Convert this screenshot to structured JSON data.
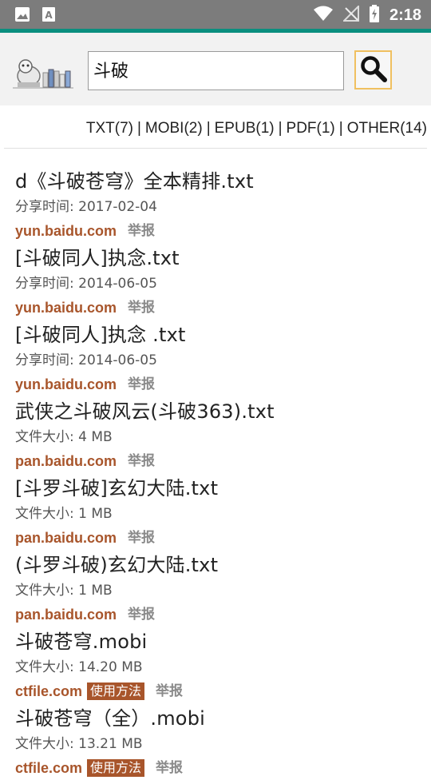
{
  "status_bar": {
    "time": "2:18",
    "left_icons": [
      "image-icon",
      "text-a-icon"
    ],
    "right_icons": [
      "wifi-icon",
      "no-signal-icon",
      "battery-charging-icon"
    ]
  },
  "header": {
    "search_value": "斗破",
    "search_icon": "magnifier-icon"
  },
  "filters": {
    "items": [
      {
        "label": "TXT(7)"
      },
      {
        "label": "MOBI(2)"
      },
      {
        "label": "EPUB(1)"
      },
      {
        "label": "PDF(1)"
      },
      {
        "label": "OTHER(14)"
      }
    ],
    "separator": "|"
  },
  "results": [
    {
      "title": "d《斗破苍穹》全本精排.txt",
      "meta": "分享时间: 2017-02-04",
      "source": "yun.baidu.com",
      "usage": "",
      "report": "举报"
    },
    {
      "title": "[斗破同人]执念.txt",
      "meta": "分享时间: 2014-06-05",
      "source": "yun.baidu.com",
      "usage": "",
      "report": "举报"
    },
    {
      "title": "[斗破同人]执念 .txt",
      "meta": "分享时间: 2014-06-05",
      "source": "yun.baidu.com",
      "usage": "",
      "report": "举报"
    },
    {
      "title": "武侠之斗破风云(斗破363).txt",
      "meta": "文件大小: 4 MB",
      "source": "pan.baidu.com",
      "usage": "",
      "report": "举报"
    },
    {
      "title": "[斗罗斗破]玄幻大陆.txt",
      "meta": "文件大小: 1 MB",
      "source": "pan.baidu.com",
      "usage": "",
      "report": "举报"
    },
    {
      "title": "(斗罗斗破)玄幻大陆.txt",
      "meta": "文件大小: 1 MB",
      "source": "pan.baidu.com",
      "usage": "",
      "report": "举报"
    },
    {
      "title": "斗破苍穹.mobi",
      "meta": "文件大小: 14.20 MB",
      "source": "ctfile.com",
      "usage": "使用方法",
      "report": "举报"
    },
    {
      "title": "斗破苍穹（全）.mobi",
      "meta": "文件大小: 13.21 MB",
      "source": "ctfile.com",
      "usage": "使用方法",
      "report": "举报"
    }
  ],
  "colors": {
    "accent": "#0b8f7f",
    "source_link": "#a8552b",
    "report": "#8a8a8a"
  }
}
